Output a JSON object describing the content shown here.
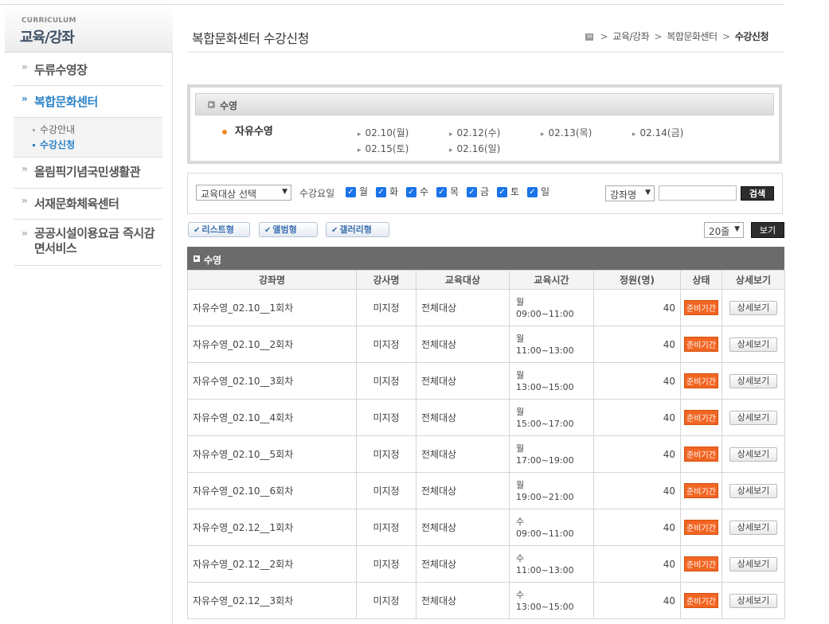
{
  "sidebar": {
    "header_en": "CURRICULUM",
    "header_ko": "교육/강좌",
    "menu": [
      {
        "label": "두류수영장"
      },
      {
        "label": "복합문화센터"
      },
      {
        "label": "올림픽기념국민생활관"
      },
      {
        "label": "서재문화체육센터"
      },
      {
        "label": "공공시설이용요금 즉시감면서비스"
      }
    ],
    "submenu": [
      {
        "label": "수강안내"
      },
      {
        "label": "수강신청"
      }
    ]
  },
  "header": {
    "title": "복합문화센터 수강신청",
    "breadcrumb": [
      "교육/강좌",
      "복합문화센터",
      "수강신청"
    ],
    "home_icon": "H"
  },
  "category": {
    "label": "수영",
    "item": "자유수영",
    "dates": [
      "02.10(월)",
      "02.12(수)",
      "02.13(목)",
      "02.14(금)",
      "02.15(토)",
      "02.16(일)"
    ]
  },
  "filter": {
    "target_select": "교육대상 선택",
    "days_label": "수강요일",
    "days": [
      "월",
      "화",
      "수",
      "목",
      "금",
      "토",
      "일"
    ],
    "field_select": "강좌명",
    "search_value": "",
    "search_button": "검색"
  },
  "view": {
    "list": "리스트형",
    "album": "앨범형",
    "gallery": "갤러리형",
    "per_page": "20줄",
    "view_button": "보기"
  },
  "table": {
    "section": "수영",
    "headers": [
      "강좌명",
      "강사명",
      "교육대상",
      "교육시간",
      "정원(명)",
      "상태",
      "상세보기"
    ],
    "rows": [
      {
        "name": "자유수영_02.10__1회차",
        "teacher": "미지정",
        "target": "전체대상",
        "day": "월",
        "time": "09:00~11:00",
        "cap": "40",
        "status": "준비기간",
        "detail": "상세보기"
      },
      {
        "name": "자유수영_02.10__2회차",
        "teacher": "미지정",
        "target": "전체대상",
        "day": "월",
        "time": "11:00~13:00",
        "cap": "40",
        "status": "준비기간",
        "detail": "상세보기"
      },
      {
        "name": "자유수영_02.10__3회차",
        "teacher": "미지정",
        "target": "전체대상",
        "day": "월",
        "time": "13:00~15:00",
        "cap": "40",
        "status": "준비기간",
        "detail": "상세보기"
      },
      {
        "name": "자유수영_02.10__4회차",
        "teacher": "미지정",
        "target": "전체대상",
        "day": "월",
        "time": "15:00~17:00",
        "cap": "40",
        "status": "준비기간",
        "detail": "상세보기"
      },
      {
        "name": "자유수영_02.10__5회차",
        "teacher": "미지정",
        "target": "전체대상",
        "day": "월",
        "time": "17:00~19:00",
        "cap": "40",
        "status": "준비기간",
        "detail": "상세보기"
      },
      {
        "name": "자유수영_02.10__6회차",
        "teacher": "미지정",
        "target": "전체대상",
        "day": "월",
        "time": "19:00~21:00",
        "cap": "40",
        "status": "준비기간",
        "detail": "상세보기"
      },
      {
        "name": "자유수영_02.12__1회차",
        "teacher": "미지정",
        "target": "전체대상",
        "day": "수",
        "time": "09:00~11:00",
        "cap": "40",
        "status": "준비기간",
        "detail": "상세보기"
      },
      {
        "name": "자유수영_02.12__2회차",
        "teacher": "미지정",
        "target": "전체대상",
        "day": "수",
        "time": "11:00~13:00",
        "cap": "40",
        "status": "준비기간",
        "detail": "상세보기"
      },
      {
        "name": "자유수영_02.12__3회차",
        "teacher": "미지정",
        "target": "전체대상",
        "day": "수",
        "time": "13:00~15:00",
        "cap": "40",
        "status": "준비기간",
        "detail": "상세보기"
      }
    ]
  }
}
